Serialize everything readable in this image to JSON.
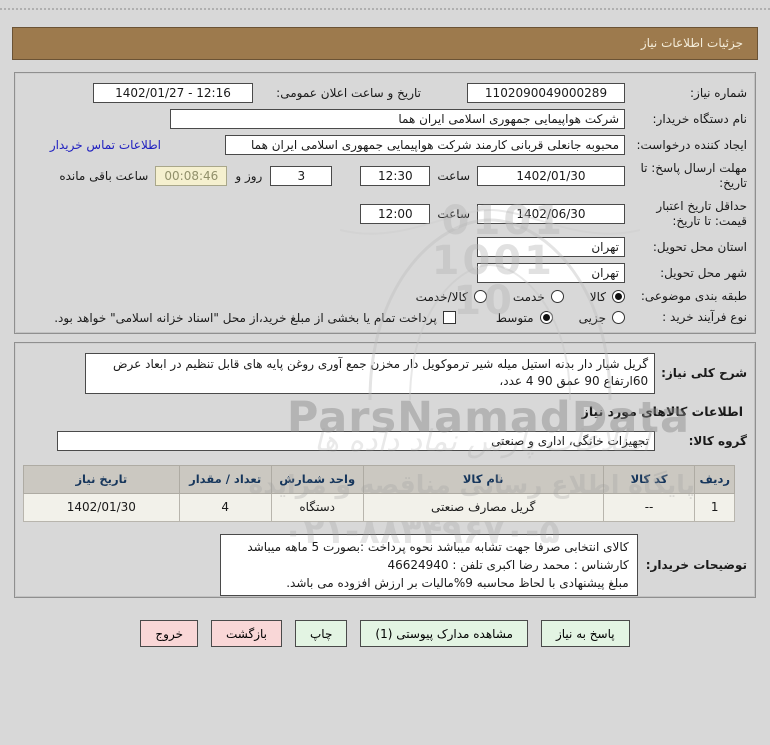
{
  "header": {
    "title": "جزئیات اطلاعات نیاز"
  },
  "general": {
    "need_number": {
      "label": "شماره نیاز:",
      "value": "1102090049000289"
    },
    "announce_datetime": {
      "label": "تاریخ و ساعت اعلان عمومی:",
      "value": "1402/01/27 - 12:16"
    },
    "buyer_name": {
      "label": "نام دستگاه خریدار:",
      "value": "شرکت هواپیمایی جمهوری اسلامی ایران هما"
    },
    "request_creator": {
      "label": "ایجاد کننده درخواست:",
      "value": "محبوبه جانعلی قربانی کارمند شرکت هواپیمایی جمهوری اسلامی ایران هما",
      "contact_link": "اطلاعات تماس خریدار"
    },
    "reply_deadline": {
      "label": "مهلت ارسال پاسخ: تا تاریخ:",
      "date": "1402/01/30",
      "hour_label": "ساعت",
      "time": "12:30",
      "days": "3",
      "days_label": "روز و",
      "countdown": "00:08:46",
      "remaining_label": "ساعت باقی مانده"
    },
    "price_validity": {
      "label": "حداقل تاریخ اعتبار قیمت: تا تاریخ:",
      "date": "1402/06/30",
      "hour_label": "ساعت",
      "time": "12:00"
    },
    "province": {
      "label": "استان محل تحویل:",
      "value": "تهران"
    },
    "city": {
      "label": "شهر محل تحویل:",
      "value": "تهران"
    },
    "classification": {
      "label": "طبقه بندی موضوعی:",
      "options": [
        {
          "label": "کالا",
          "selected": true
        },
        {
          "label": "خدمت",
          "selected": false
        },
        {
          "label": "کالا/خدمت",
          "selected": false
        }
      ]
    },
    "process_type": {
      "label": "نوع فرآیند خرید :",
      "options": [
        {
          "label": "جزیی",
          "selected": false
        },
        {
          "label": "متوسط",
          "selected": true
        }
      ],
      "checkbox_label": "پرداخت تمام یا بخشی از مبلغ خرید،از محل \"اسناد خزانه اسلامی\" خواهد بود.",
      "checkbox_checked": false
    }
  },
  "need": {
    "description": {
      "label": "شرح کلی نیاز:",
      "value": "گریل شیار دار بدنه استیل میله شیر ترموکویل دار  مخزن جمع آوری روغن پایه های قابل تنظیم در ابعاد عرض 60ارتفاع 90 عمق 90  4 عدد،"
    },
    "goods_section_title": "اطلاعات کالاهای مورد نیاز",
    "goods_group": {
      "label": "گروه کالا:",
      "value": "تجهیزات خانگی، اداری و صنعتی"
    },
    "table": {
      "headers": [
        "ردیف",
        "کد کالا",
        "نام کالا",
        "واحد شمارش",
        "تعداد / مقدار",
        "تاریخ نیاز"
      ],
      "rows": [
        {
          "row": "1",
          "code": "--",
          "name": "گریل مصارف صنعتی",
          "unit": "دستگاه",
          "qty": "4",
          "date": "1402/01/30"
        }
      ]
    },
    "buyer_notes": {
      "label": "توضیحات خریدار:",
      "line1": "کالای انتخابی صرفا جهت تشابه میباشد نحوه پرداخت :بصورت 5 ماهه میباشد",
      "line2": "کارشناس : محمد رضا اکبری   تلفن  : 46624940",
      "line3": "مبلغ پیشنهادی با لحاظ محاسبه 9%مالیات بر ارزش افزوده می باشد."
    }
  },
  "buttons": [
    {
      "label": "پاسخ به نیاز",
      "style": "green"
    },
    {
      "label": "مشاهده مدارک پیوستی (1)",
      "style": "green"
    },
    {
      "label": "چاپ",
      "style": "green"
    },
    {
      "label": "بازگشت",
      "style": "pink"
    },
    {
      "label": "خروج",
      "style": "pink"
    }
  ],
  "watermark": {
    "brand": "ParsNamadData",
    "calligraphy": "اطلاعات پارس نماد داده ها",
    "tagline": "پایگاه اطلاع رسانی مناقصه و مزایده",
    "phone": "۰۲۱-۸۸۳۴۹۶۷۰-۵",
    "digits1": "0101",
    "digits2": "1001",
    "digits3": "10"
  },
  "colors": {
    "accent_brown": "#9d7a4d",
    "button_green": "#e3f4e3",
    "button_pink": "#f9d7d7",
    "link_blue": "#2020c0",
    "table_header_text": "#16365c"
  }
}
